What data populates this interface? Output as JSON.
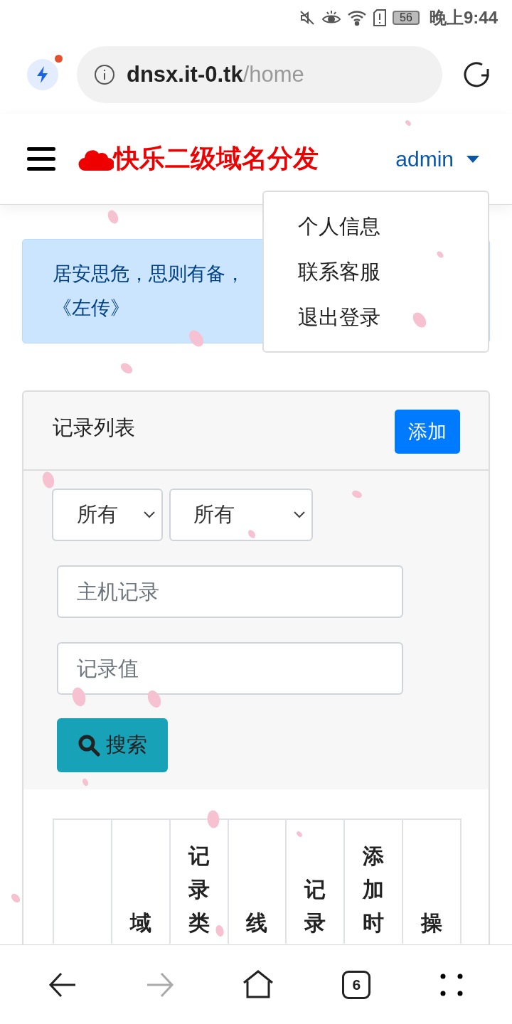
{
  "status_bar": {
    "battery": "56",
    "time": "晚上9:44"
  },
  "browser": {
    "url_host": "dnsx.it-0.tk",
    "url_path": "/home"
  },
  "navbar": {
    "title": "快乐二级域名分发",
    "user": "admin"
  },
  "user_menu": [
    {
      "label": "个人信息"
    },
    {
      "label": "联系客服"
    },
    {
      "label": "退出登录"
    }
  ],
  "alert": {
    "lines": [
      "居安思危，思则有备，",
      "《左传》"
    ]
  },
  "card": {
    "title": "记录列表",
    "add_button": "添加",
    "filters": [
      {
        "kind": "select",
        "value": "所有"
      },
      {
        "kind": "select",
        "value": "所有"
      }
    ],
    "fields": [
      {
        "placeholder": "主机记录"
      },
      {
        "placeholder": "记录值"
      }
    ],
    "search_button": "搜索"
  },
  "table": {
    "columns": [
      {
        "label": "域"
      },
      {
        "label": "记录类"
      },
      {
        "label": "线"
      },
      {
        "label": "记录"
      },
      {
        "label": "添加时"
      },
      {
        "label": "操"
      }
    ]
  },
  "bottom_nav": {
    "back": {
      "disabled": false
    },
    "forward": {
      "disabled": true
    },
    "tabs_count": "6"
  }
}
